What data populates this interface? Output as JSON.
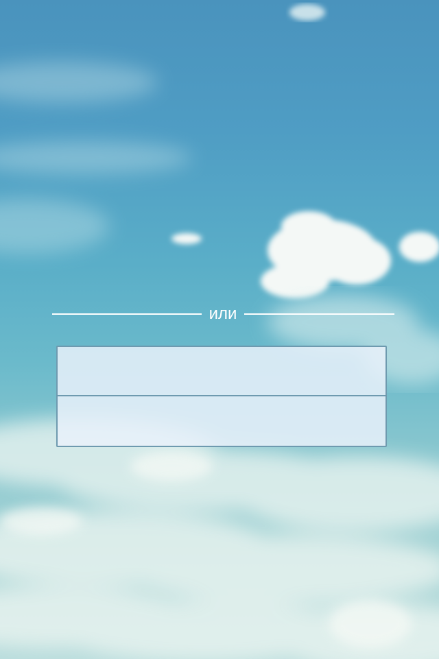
{
  "divider": {
    "label": "или"
  },
  "login_form": {
    "login_field": {
      "value": "",
      "placeholder": ""
    },
    "password_field": {
      "value": "",
      "placeholder": ""
    }
  },
  "colors": {
    "sky_top": "#4a93bd",
    "sky_bottom": "#b8dcdc",
    "field_background": "#e9f1fa",
    "field_border": "#6e9aaf",
    "divider_color": "#ffffff"
  }
}
